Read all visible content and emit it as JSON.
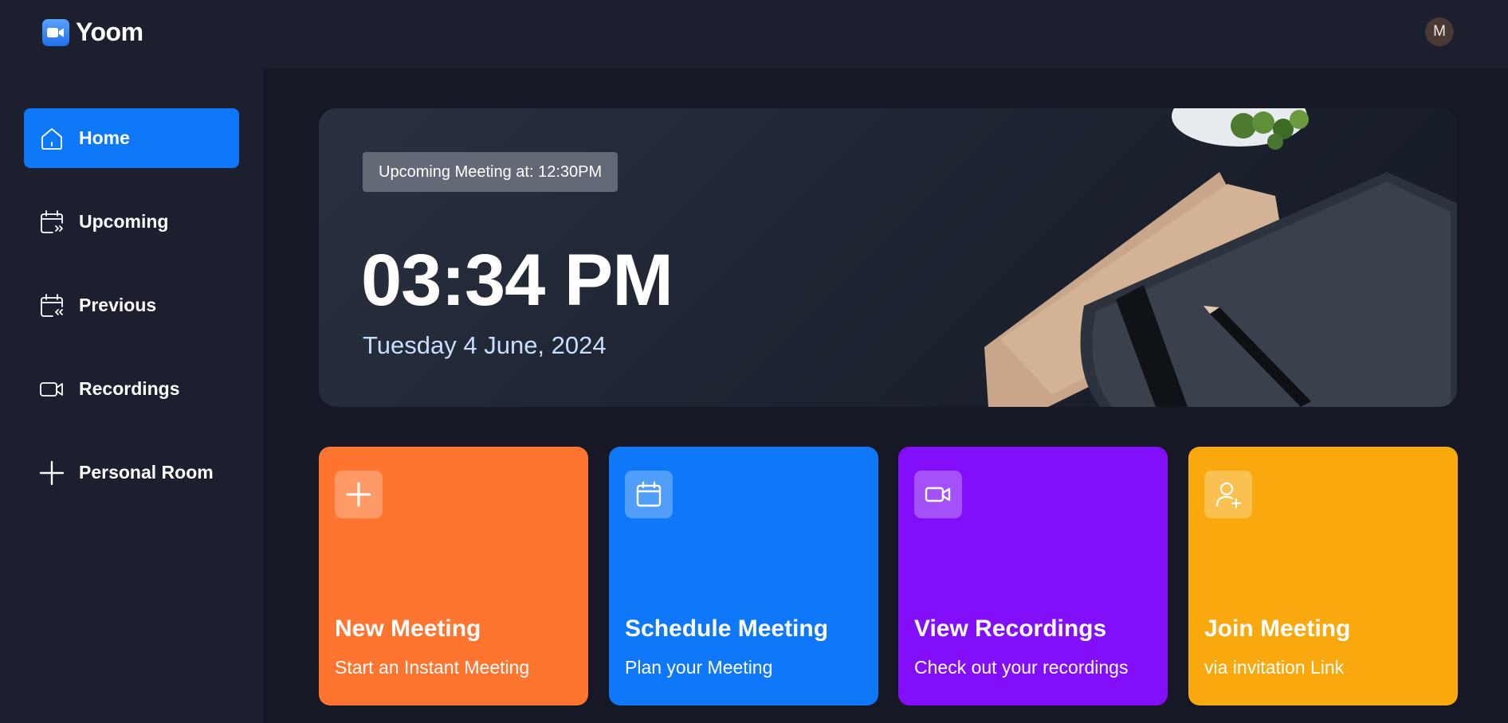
{
  "app": {
    "name": "Yoom"
  },
  "user": {
    "avatar_initial": "M"
  },
  "sidebar": {
    "items": [
      {
        "label": "Home",
        "icon": "home-icon",
        "active": true
      },
      {
        "label": "Upcoming",
        "icon": "calendar-upcoming-icon",
        "active": false
      },
      {
        "label": "Previous",
        "icon": "calendar-previous-icon",
        "active": false
      },
      {
        "label": "Recordings",
        "icon": "video-icon",
        "active": false
      },
      {
        "label": "Personal Room",
        "icon": "plus-icon",
        "active": false
      }
    ]
  },
  "hero": {
    "badge": "Upcoming Meeting at: 12:30PM",
    "time": "03:34 PM",
    "date": "Tuesday 4 June, 2024"
  },
  "cards": [
    {
      "title": "New Meeting",
      "subtitle": "Start an Instant Meeting",
      "icon": "plus-icon",
      "color": "#ff742e"
    },
    {
      "title": "Schedule Meeting",
      "subtitle": "Plan your Meeting",
      "icon": "calendar-icon",
      "color": "#0e78f9"
    },
    {
      "title": "View Recordings",
      "subtitle": "Check out your recordings",
      "icon": "video-icon",
      "color": "#830ef9"
    },
    {
      "title": "Join Meeting",
      "subtitle": "via invitation Link",
      "icon": "user-plus-icon",
      "color": "#f9a90e"
    }
  ],
  "colors": {
    "accent": "#0e78f9",
    "background": "#161925",
    "panel": "#1c1f2e"
  }
}
